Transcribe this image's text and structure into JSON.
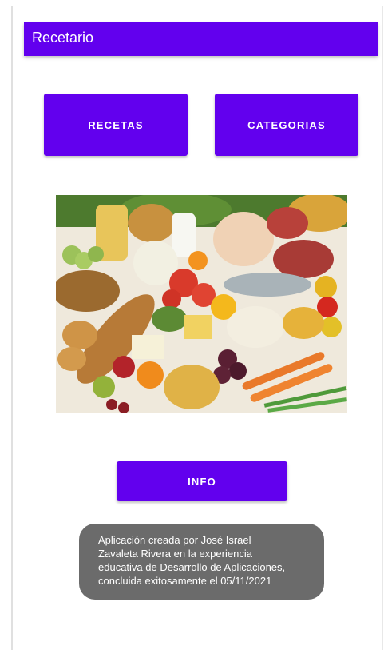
{
  "app_bar": {
    "title": "Recetario",
    "color": "#6200ee"
  },
  "buttons": {
    "recetas_label": "RECETAS",
    "categorias_label": "CATEGORIAS",
    "info_label": "INFO"
  },
  "image": {
    "subject": "food-groceries-photo"
  },
  "toast": {
    "lines": [
      "Aplicación creada por José Israel",
      "Zavaleta Rivera en la experiencia",
      "educativa de Desarrollo de Aplicaciones,",
      "concluida exitosamente el 05/11/2021"
    ]
  }
}
